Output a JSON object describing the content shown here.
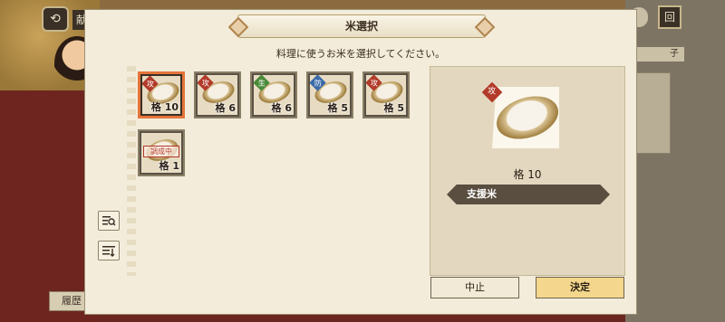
{
  "background": {
    "top_left_label": "献",
    "top_right_icon": "回",
    "right_label": "子",
    "bottom_left_label": "履歴"
  },
  "dialog": {
    "title": "米選択",
    "subtitle": "料理に使うお米を選択してください。",
    "items": [
      {
        "stat": "攻",
        "stat_color": "#b23a2a",
        "tier": "格 10",
        "selected": true
      },
      {
        "stat": "攻",
        "stat_color": "#b23a2a",
        "tier": "格 6",
        "selected": false
      },
      {
        "stat": "生",
        "stat_color": "#4a8a3a",
        "tier": "格 6",
        "selected": false
      },
      {
        "stat": "防",
        "stat_color": "#3a6aa8",
        "tier": "格 5",
        "selected": false
      },
      {
        "stat": "攻",
        "stat_color": "#b23a2a",
        "tier": "格 5",
        "selected": false
      },
      {
        "stat": "",
        "stat_color": "#b23a2a",
        "tier": "格 1",
        "selected": false,
        "stamp": "調成中"
      }
    ],
    "detail": {
      "stat": "攻",
      "tier": "格 10",
      "name": "支援米"
    },
    "buttons": {
      "cancel": "中止",
      "confirm": "決定"
    },
    "tools": [
      "search-list-icon",
      "sort-list-icon"
    ]
  }
}
